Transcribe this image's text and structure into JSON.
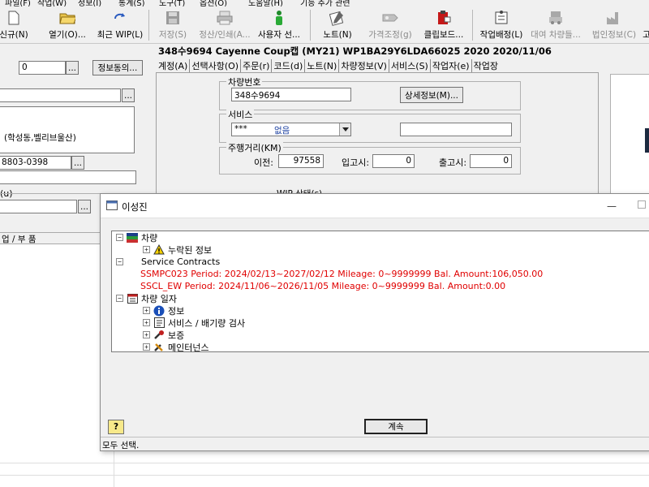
{
  "menubar": {
    "items": [
      "파일(F)",
      "작업(W)",
      "정보(I)",
      "통계(S)",
      "도구(T)",
      "옵션(O)",
      "도움말(H)",
      "기능 추가 관련"
    ]
  },
  "toolbar": {
    "new": "신규(N)",
    "open": "열기(O)...",
    "recent_wip": "최근 WIP(L)",
    "save": "저장(S)",
    "settle_print": "정산/인쇄(A...",
    "user_select": "사용자 선...",
    "notes": "노트(N)",
    "price_adjust": "가격조정(g)",
    "clipboard": "클립보드...",
    "work_assign": "작업배정(L)",
    "rental_vehicle": "대여 차량들...",
    "corporate_info": "법인정보(C)",
    "more": "고"
  },
  "vehicle": {
    "title": "348수9694 Cayenne Coup캡 (MY21) WP1BA29Y6LDA66025 2020 2020/11/06"
  },
  "tabs": [
    "계정(A)",
    "선택사항(O)",
    "주문(r)",
    "코드(d)",
    "노트(N)",
    "차량정보(V)",
    "서비스(S)",
    "작업자(e)",
    "작업장"
  ],
  "left": {
    "field_value": "0",
    "browse": "...",
    "info_consent": "정보동의...",
    "address": "(학성동,벨리브울산)",
    "phone": "8803-0398",
    "group_label": "(u)",
    "column_header": "업 / 부 품"
  },
  "vehicle_no_group": {
    "title": "차량번호",
    "value": "348수9694",
    "detail_button": "상세정보(M)..."
  },
  "service_group": {
    "title": "서비스",
    "code": "***",
    "value": "없음",
    "extra": ""
  },
  "mileage_group": {
    "title": "주행거리(KM)",
    "previous_label": "이전:",
    "previous_value": "97558",
    "in_label": "입고시:",
    "in_value": "0",
    "out_label": "출고시:",
    "out_value": "0"
  },
  "wip_status": {
    "title": "WIP 상태(s)"
  },
  "dialog": {
    "title": "이성진",
    "tree": {
      "vehicle": "차량",
      "missing_info": "누락된 정보",
      "service_contracts": "Service Contracts",
      "contract_1": "SSMPC023 Period: 2024/02/13~2027/02/12 Mileage: 0~9999999 Bal. Amount:106,050.00",
      "contract_2": "SSCL_EW Period: 2024/11/06~2026/11/05 Mileage: 0~9999999 Bal. Amount:0.00",
      "vehicle_history": "차량 일자",
      "info": "정보",
      "service_emission": "서비스 / 배기량 검사",
      "warranty": "보증",
      "maintenance": "메인터넌스"
    },
    "help": "?",
    "continue_button": "계속"
  },
  "status_bar": {
    "text": "모두 선택."
  },
  "colors": {
    "contract_text": "#e00000",
    "link_blue": "#1a3fa0",
    "window_bg": "#f0f0f0"
  }
}
